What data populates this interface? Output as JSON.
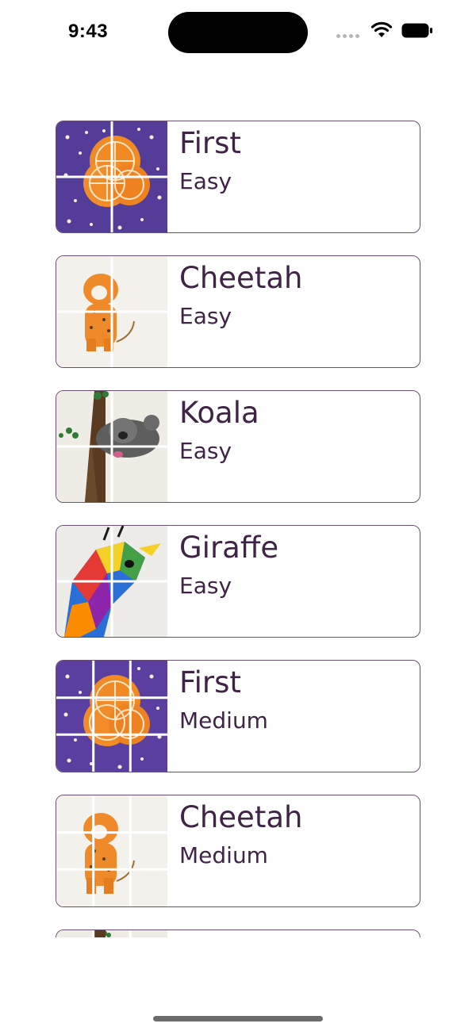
{
  "status_bar": {
    "time": "9:43",
    "icons": [
      "cellular-signal-icon",
      "wifi-icon",
      "battery-icon"
    ]
  },
  "puzzles": [
    {
      "title": "First",
      "level": "Easy",
      "image": "orange-moon-painting",
      "grid": "2x2"
    },
    {
      "title": "Cheetah",
      "level": "Easy",
      "image": "cheetah-painting",
      "grid": "2x2"
    },
    {
      "title": "Koala",
      "level": "Easy",
      "image": "koala-painting",
      "grid": "2x2"
    },
    {
      "title": "Giraffe",
      "level": "Easy",
      "image": "giraffe-painting",
      "grid": "2x2"
    },
    {
      "title": "First",
      "level": "Medium",
      "image": "orange-moon-painting",
      "grid": "3x3"
    },
    {
      "title": "Cheetah",
      "level": "Medium",
      "image": "cheetah-painting",
      "grid": "3x3"
    },
    {
      "title": "",
      "level": "",
      "image": "koala-painting",
      "grid": "3x3"
    }
  ],
  "colors": {
    "text": "#3f2446",
    "card_border": "#6b4f70",
    "background": "#ffffff"
  }
}
